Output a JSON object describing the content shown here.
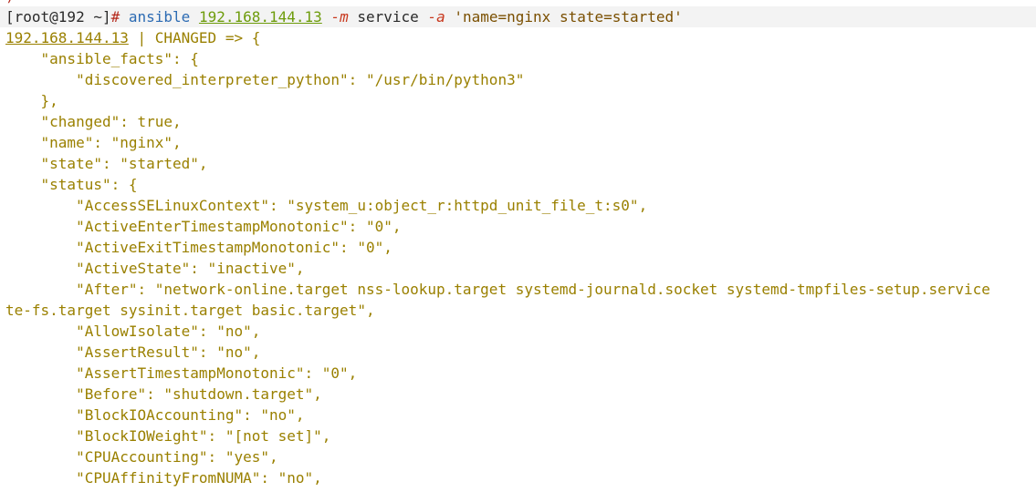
{
  "prompt": {
    "sliver": ")",
    "user_host": "[root@192 ~]",
    "hash": "#",
    "command": "ansible",
    "target_ip": "192.168.144.13",
    "module_flag": "-m",
    "module": "service",
    "args_flag": "-a",
    "args": "'name=nginx state=started'"
  },
  "result_header": {
    "host": "192.168.144.13",
    "status": " | CHANGED => {"
  },
  "output_lines": [
    "    \"ansible_facts\": {",
    "        \"discovered_interpreter_python\": \"/usr/bin/python3\"",
    "    },",
    "    \"changed\": true,",
    "    \"name\": \"nginx\",",
    "    \"state\": \"started\",",
    "    \"status\": {",
    "        \"AccessSELinuxContext\": \"system_u:object_r:httpd_unit_file_t:s0\",",
    "        \"ActiveEnterTimestampMonotonic\": \"0\",",
    "        \"ActiveExitTimestampMonotonic\": \"0\",",
    "        \"ActiveState\": \"inactive\",",
    "        \"After\": \"network-online.target nss-lookup.target systemd-journald.socket systemd-tmpfiles-setup.service",
    "te-fs.target sysinit.target basic.target\",",
    "        \"AllowIsolate\": \"no\",",
    "        \"AssertResult\": \"no\",",
    "        \"AssertTimestampMonotonic\": \"0\",",
    "        \"Before\": \"shutdown.target\",",
    "        \"BlockIOAccounting\": \"no\",",
    "        \"BlockIOWeight\": \"[not set]\",",
    "        \"CPUAccounting\": \"yes\",",
    "        \"CPUAffinityFromNUMA\": \"no\","
  ]
}
